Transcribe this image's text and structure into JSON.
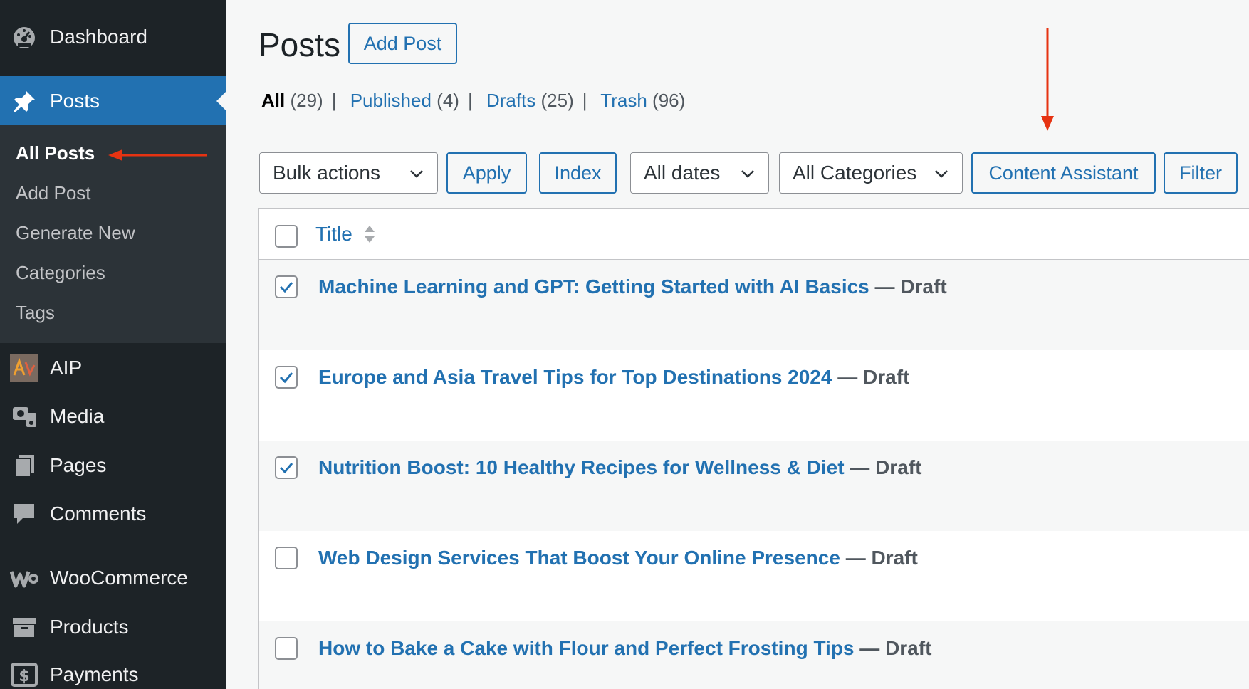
{
  "sidebar": {
    "dashboard": "Dashboard",
    "posts": "Posts",
    "submenu": [
      "All Posts",
      "Add Post",
      "Generate New",
      "Categories",
      "Tags"
    ],
    "aip": "AIP",
    "media": "Media",
    "pages": "Pages",
    "comments": "Comments",
    "woocommerce": "WooCommerce",
    "products": "Products",
    "payments": "Payments"
  },
  "header": {
    "title": "Posts",
    "add_post": "Add Post"
  },
  "filters_links": {
    "all": "All",
    "all_count": "(29)",
    "published": "Published",
    "published_count": "(4)",
    "drafts": "Drafts",
    "drafts_count": "(25)",
    "trash": "Trash",
    "trash_count": "(96)"
  },
  "toolbar": {
    "bulk_actions": "Bulk actions",
    "apply": "Apply",
    "index": "Index",
    "all_dates": "All dates",
    "all_categories": "All Categories",
    "content_assistant": "Content Assistant",
    "filter": "Filter"
  },
  "table": {
    "column_title": "Title",
    "state_separator": "—",
    "rows": [
      {
        "title": "Machine Learning and GPT: Getting Started with AI Basics",
        "state": "Draft",
        "checked": true
      },
      {
        "title": "Europe and Asia Travel Tips for Top Destinations 2024",
        "state": "Draft",
        "checked": true
      },
      {
        "title": "Nutrition Boost: 10 Healthy Recipes for Wellness & Diet",
        "state": "Draft",
        "checked": true
      },
      {
        "title": "Web Design Services That Boost Your Online Presence",
        "state": "Draft",
        "checked": false
      },
      {
        "title": "How to Bake a Cake with Flour and Perfect Frosting Tips",
        "state": "Draft",
        "checked": false
      }
    ]
  },
  "colors": {
    "sidebar_bg": "#1d2327",
    "submenu_bg": "#2c3338",
    "accent": "#2271b1",
    "annotation_arrow": "#e63312"
  },
  "icons": [
    "dashboard-icon",
    "pushpin-icon",
    "aip-logo-icon",
    "media-icon",
    "pages-icon",
    "comments-icon",
    "woocommerce-icon",
    "products-icon",
    "payments-icon"
  ]
}
